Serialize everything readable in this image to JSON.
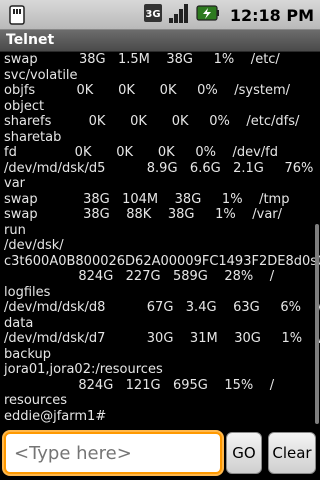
{
  "status": {
    "time": "12:18 PM",
    "network": "3G"
  },
  "window": {
    "title": "Telnet"
  },
  "terminal": {
    "lines": [
      "swap          38G   1.5M    38G     1%    /etc/",
      "svc/volatile",
      "objfs          0K      0K      0K     0%    /system/",
      "object",
      "sharefs         0K      0K      0K     0%    /etc/dfs/",
      "sharetab",
      "fd              0K      0K      0K     0%    /dev/fd",
      "/dev/md/dsk/d5          8.9G   6.6G   2.1G     76%    /",
      "var",
      "swap           38G   104M    38G     1%    /tmp",
      "swap           38G    88K    38G     1%    /var/",
      "run",
      "/dev/dsk/",
      "c3t600A0B800026D62A00009FC1493F2DE8d0s0",
      "                  824G   227G   589G    28%    /",
      "logfiles",
      "/dev/md/dsk/d8          67G   3.4G    63G     6%    /",
      "data",
      "/dev/md/dsk/d7          30G    31M    30G     1%    /",
      "backup",
      "jora01,jora02:/resources",
      "                  824G   121G   695G    15%    /",
      "resources",
      "eddie@jfarm1#"
    ]
  },
  "input": {
    "placeholder": "<Type here>",
    "value": ""
  },
  "buttons": {
    "go": "GO",
    "clear": "Clear"
  }
}
